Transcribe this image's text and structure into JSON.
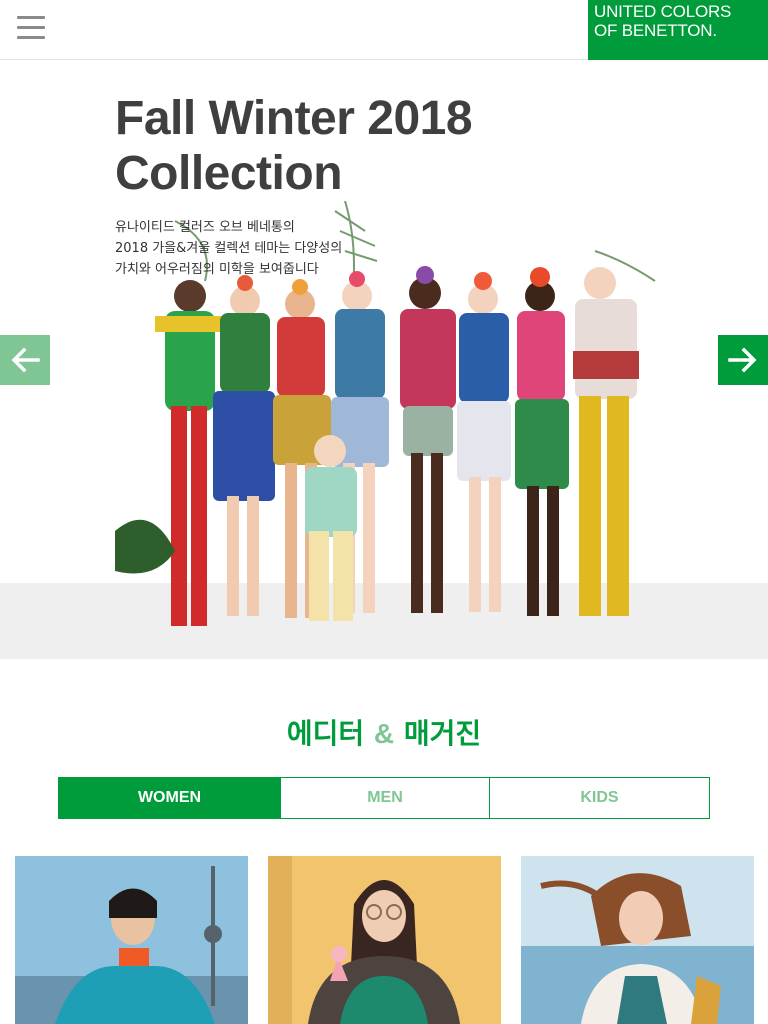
{
  "header": {
    "menu_icon": "hamburger-menu-icon",
    "logo_line1": "UNITED COLORS",
    "logo_line2": "OF BENETTON.",
    "brand_color": "#009c3b"
  },
  "hero": {
    "title_line1": "Fall Winter 2018",
    "title_line2": "Collection",
    "description": "유나이티드 컬러즈 오브 베네통의\n2018 가을&겨울 컬렉션 테마는 다양성의\n가치와 어우러짐의 미학을 보여줍니다",
    "prev_icon": "arrow-left-icon",
    "next_icon": "arrow-right-icon",
    "slides": 3,
    "active_slide": 1
  },
  "section": {
    "title_part1": "에디터",
    "title_amp": "&",
    "title_part2": "매거진"
  },
  "tabs": [
    {
      "label": "WOMEN",
      "active": true
    },
    {
      "label": "MEN",
      "active": false
    },
    {
      "label": "KIDS",
      "active": false
    }
  ],
  "colors": {
    "accent": "#009c3b",
    "accent_light": "#7fc694"
  }
}
